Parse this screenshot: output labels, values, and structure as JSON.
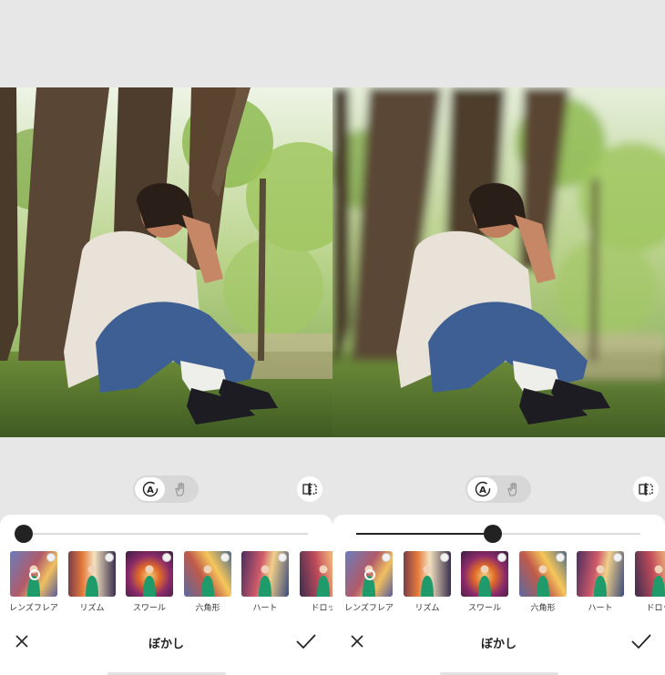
{
  "panels": [
    {
      "id": "before",
      "slider": {
        "value": 0
      },
      "mode_toggle": {
        "auto_icon": "auto-a-icon",
        "manual_icon": "hand-brush-icon",
        "active": "auto"
      },
      "compare_icon": "compare-icon",
      "effects": [
        {
          "label": "レンズフレア",
          "selected": true,
          "icon": "premium-gem-icon"
        },
        {
          "label": "リズム",
          "selected": false,
          "icon": "premium-gem-icon"
        },
        {
          "label": "スワール",
          "selected": false,
          "icon": "premium-gem-icon"
        },
        {
          "label": "六角形",
          "selected": false,
          "icon": "premium-gem-icon"
        },
        {
          "label": "ハート",
          "selected": false,
          "icon": "premium-gem-icon"
        },
        {
          "label": "ドロッ",
          "selected": false,
          "icon": "premium-gem-icon"
        }
      ],
      "title": "ぼかし",
      "close_icon": "close-icon",
      "confirm_icon": "checkmark-icon"
    },
    {
      "id": "after",
      "slider": {
        "value": 0.48
      },
      "mode_toggle": {
        "auto_icon": "auto-a-icon",
        "manual_icon": "hand-brush-icon",
        "active": "auto"
      },
      "compare_icon": "compare-icon",
      "effects": [
        {
          "label": "レンズフレア",
          "selected": true,
          "icon": "premium-gem-icon"
        },
        {
          "label": "リズム",
          "selected": false,
          "icon": "premium-gem-icon"
        },
        {
          "label": "スワール",
          "selected": false,
          "icon": "premium-gem-icon"
        },
        {
          "label": "六角形",
          "selected": false,
          "icon": "premium-gem-icon"
        },
        {
          "label": "ハート",
          "selected": false,
          "icon": "premium-gem-icon"
        },
        {
          "label": "ドロッ",
          "selected": false,
          "icon": "premium-gem-icon"
        }
      ],
      "title": "ぼかし",
      "close_icon": "close-icon",
      "confirm_icon": "checkmark-icon"
    }
  ],
  "colors": {
    "background": "#e7e7e7",
    "sheet": "#ffffff",
    "accent": "#222222"
  }
}
